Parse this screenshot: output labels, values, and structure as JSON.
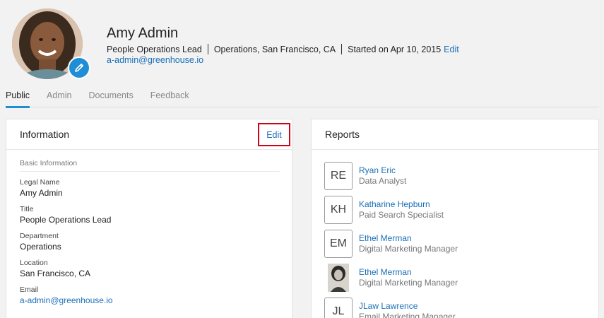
{
  "profile": {
    "name": "Amy Admin",
    "title": "People Operations Lead",
    "location": "Operations, San Francisco, CA",
    "started": "Started on Apr 10, 2015",
    "edit_label": "Edit",
    "email": "a-admin@greenhouse.io",
    "edit_photo_icon": "pencil-icon"
  },
  "tabs": [
    {
      "label": "Public",
      "active": true
    },
    {
      "label": "Admin",
      "active": false
    },
    {
      "label": "Documents",
      "active": false
    },
    {
      "label": "Feedback",
      "active": false
    }
  ],
  "information": {
    "heading": "Information",
    "edit_label": "Edit",
    "section_label": "Basic Information",
    "fields": [
      {
        "label": "Legal Name",
        "value": "Amy Admin"
      },
      {
        "label": "Title",
        "value": "People Operations Lead"
      },
      {
        "label": "Department",
        "value": "Operations"
      },
      {
        "label": "Location",
        "value": "San Francisco, CA"
      },
      {
        "label": "Email",
        "value": "a-admin@greenhouse.io"
      }
    ]
  },
  "reports": {
    "heading": "Reports",
    "items": [
      {
        "initials": "RE",
        "name": "Ryan Eric",
        "title": "Data Analyst"
      },
      {
        "initials": "KH",
        "name": "Katharine Hepburn",
        "title": "Paid Search Specialist"
      },
      {
        "initials": "EM",
        "name": "Ethel Merman",
        "title": "Digital Marketing Manager"
      },
      {
        "initials": "",
        "name": "Ethel Merman",
        "title": "Digital Marketing Manager"
      },
      {
        "initials": "JL",
        "name": "JLaw Lawrence",
        "title": "Email Marketing Manager"
      }
    ]
  }
}
